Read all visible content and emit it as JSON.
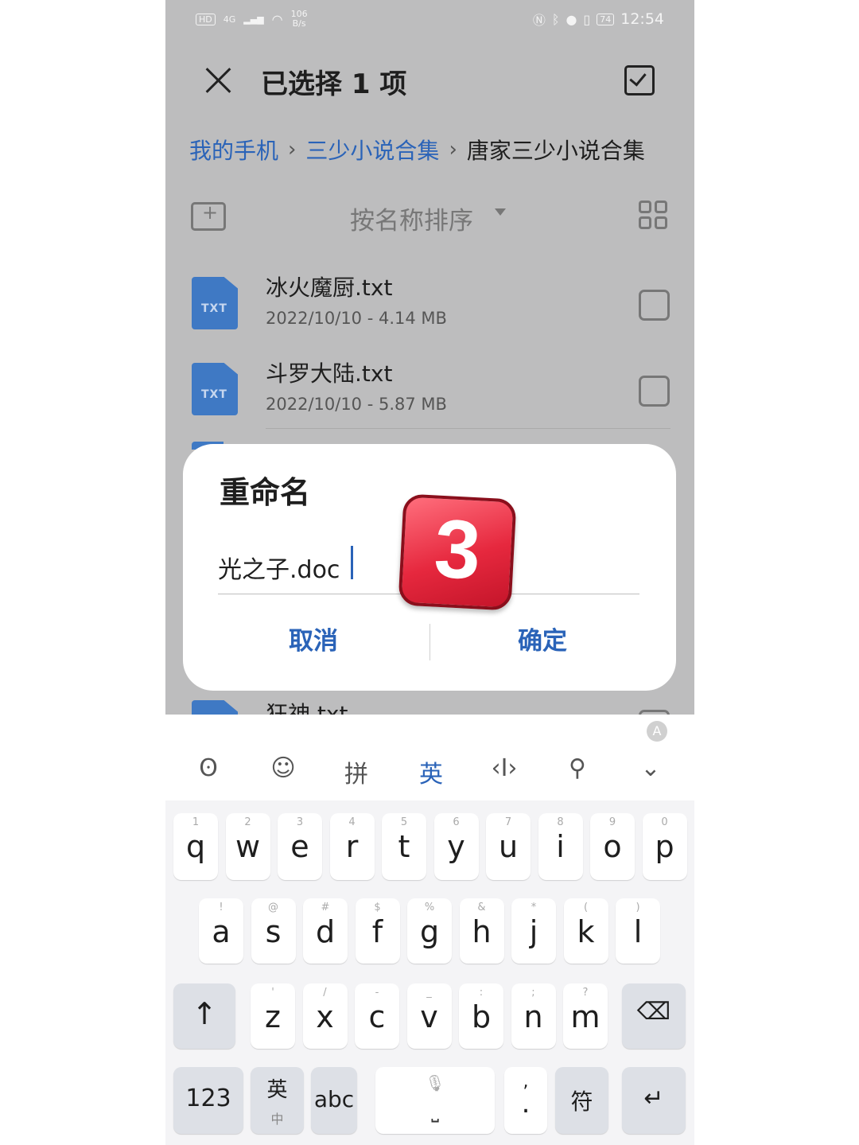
{
  "status_bar": {
    "left_chip": "HD",
    "network": "4G",
    "speed_value": "106",
    "speed_unit": "B/s",
    "battery": "74",
    "time": "12:54"
  },
  "app_bar": {
    "title": "已选择 1 项"
  },
  "breadcrumb": [
    "我的手机",
    "三少小说合集",
    "唐家三少小说合集"
  ],
  "toolbar": {
    "sort_label": "按名称排序"
  },
  "files": [
    {
      "icon_label": "TXT",
      "name": "冰火魔厨.txt",
      "meta": "2022/10/10 - 4.14 MB",
      "checked": false
    },
    {
      "icon_label": "TXT",
      "name": "斗罗大陆.txt",
      "meta": "2022/10/10 - 5.87 MB",
      "checked": false
    },
    {
      "icon_label": "TXT",
      "name": "狂神.txt",
      "meta": "",
      "checked": false
    }
  ],
  "dialog": {
    "title": "重命名",
    "input_value": "光之子.doc",
    "cancel_label": "取消",
    "confirm_label": "确定"
  },
  "badge": {
    "number": "3"
  },
  "keyboard": {
    "toolbar": [
      "拼",
      "英"
    ],
    "row1": [
      {
        "k": "q",
        "h": "1"
      },
      {
        "k": "w",
        "h": "2"
      },
      {
        "k": "e",
        "h": "3"
      },
      {
        "k": "r",
        "h": "4"
      },
      {
        "k": "t",
        "h": "5"
      },
      {
        "k": "y",
        "h": "6"
      },
      {
        "k": "u",
        "h": "7"
      },
      {
        "k": "i",
        "h": "8"
      },
      {
        "k": "o",
        "h": "9"
      },
      {
        "k": "p",
        "h": "0"
      }
    ],
    "row2": [
      {
        "k": "a",
        "h": "!"
      },
      {
        "k": "s",
        "h": "@"
      },
      {
        "k": "d",
        "h": "#"
      },
      {
        "k": "f",
        "h": "$"
      },
      {
        "k": "g",
        "h": "%"
      },
      {
        "k": "h",
        "h": "&"
      },
      {
        "k": "j",
        "h": "*"
      },
      {
        "k": "k",
        "h": "("
      },
      {
        "k": "l",
        "h": ")"
      }
    ],
    "row3": [
      {
        "k": "z",
        "h": "'"
      },
      {
        "k": "x",
        "h": "/"
      },
      {
        "k": "c",
        "h": "-"
      },
      {
        "k": "v",
        "h": "_"
      },
      {
        "k": "b",
        "h": ":"
      },
      {
        "k": "n",
        "h": ";"
      },
      {
        "k": "m",
        "h": "?"
      }
    ],
    "num_key": "123",
    "lang_key_top": "英",
    "lang_key_bottom": "中",
    "abc_key": "abc",
    "punct_top": ",",
    "punct_bottom": ".",
    "symbol_key": "符"
  }
}
